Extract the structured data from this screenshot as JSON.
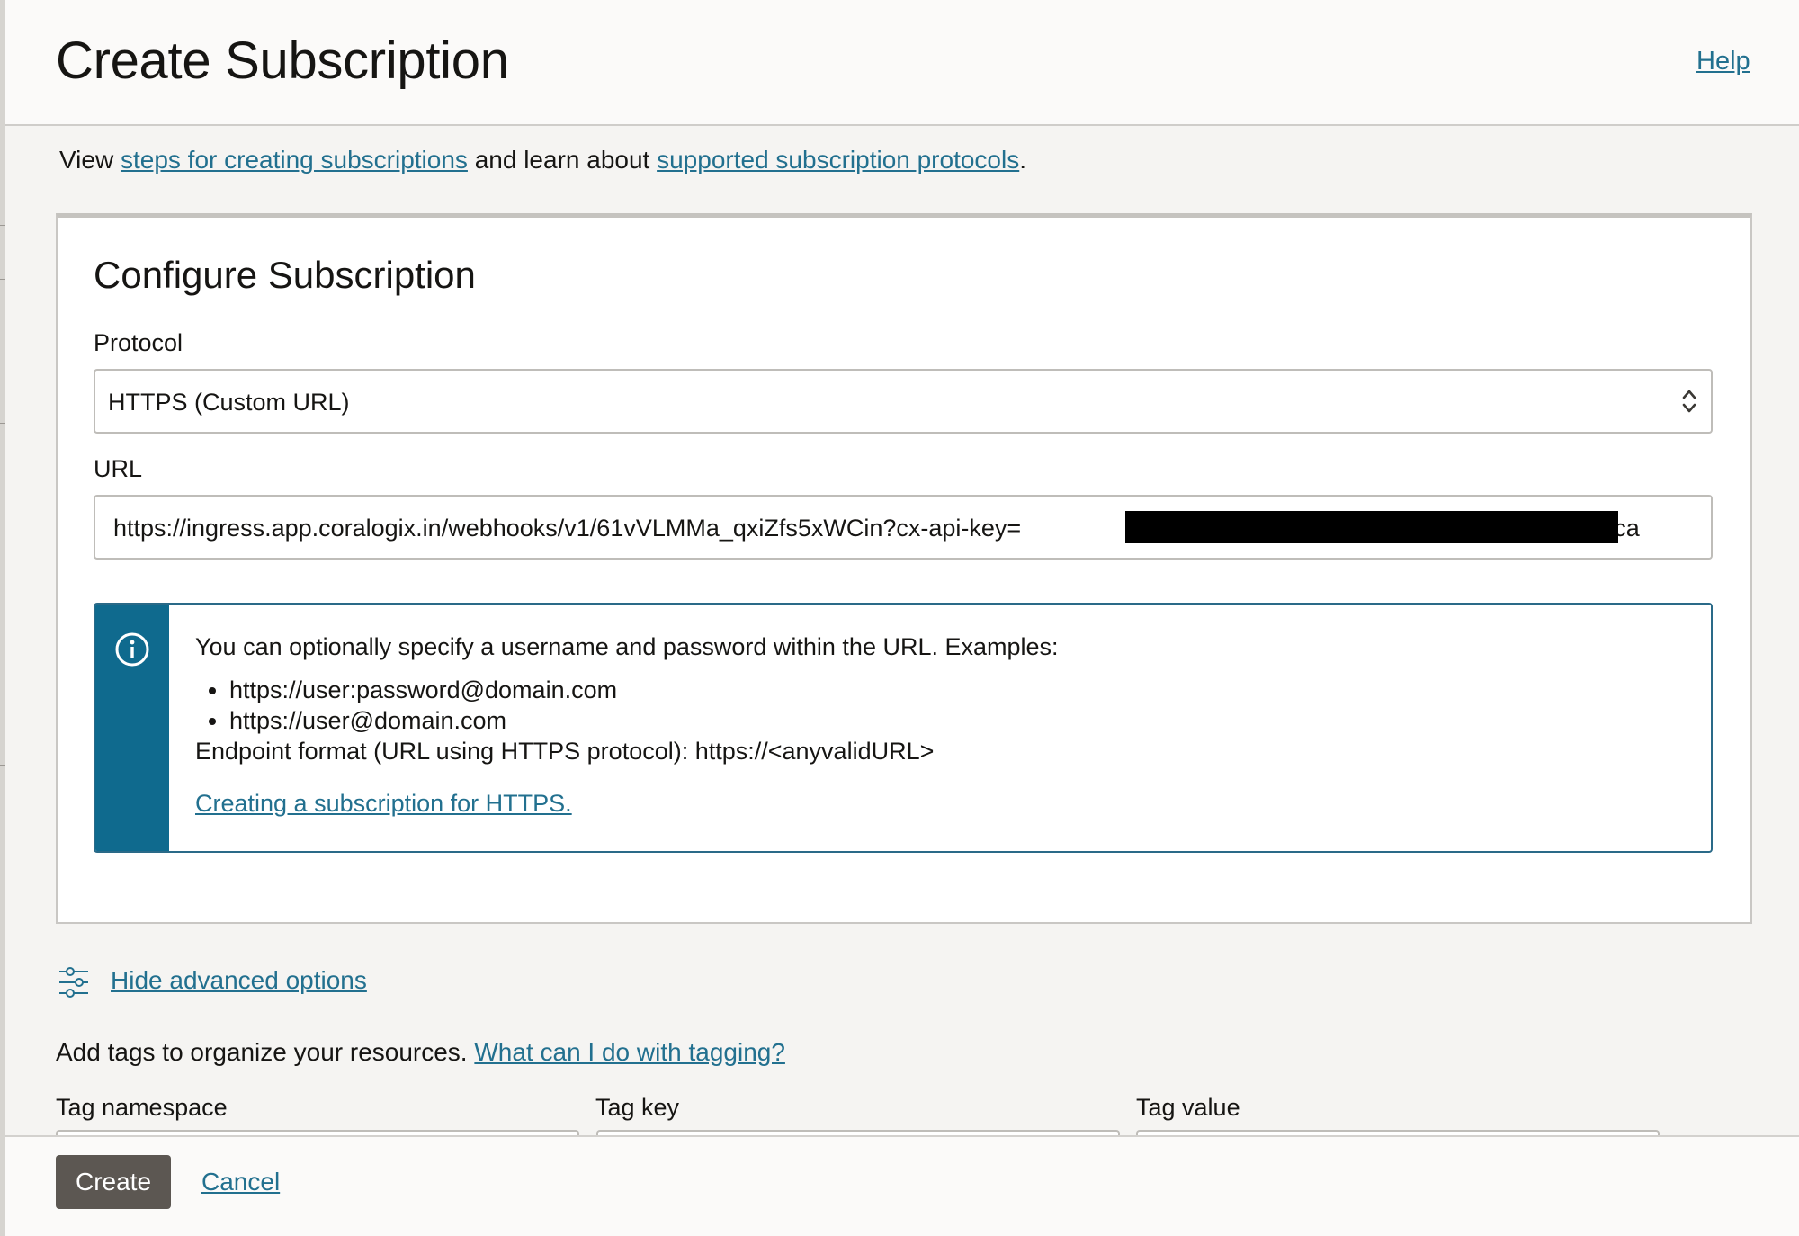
{
  "header": {
    "title": "Create Subscription",
    "help_label": "Help"
  },
  "intro": {
    "prefix": "View ",
    "link1": "steps for creating subscriptions",
    "middle": " and learn about ",
    "link2": "supported subscription protocols",
    "suffix": "."
  },
  "config": {
    "title": "Configure Subscription",
    "protocol_label": "Protocol",
    "protocol_value": "HTTPS (Custom URL)",
    "url_label": "URL",
    "url_value": "https://ingress.app.coralogix.in/webhooks/v1/61vVLMMa_qxiZfs5xWCin?cx-api-key=",
    "url_value_tail": "&cx-applica",
    "info": {
      "icon": "info-icon",
      "text": "You can optionally specify a username and password within the URL. Examples:",
      "examples": [
        "https://user:password@domain.com",
        "https://user@domain.com"
      ],
      "endpoint": "Endpoint format (URL using HTTPS protocol): https://<anyvalidURL>",
      "link": "Creating a subscription for HTTPS."
    }
  },
  "advanced": {
    "icon": "sliders-icon",
    "label": "Hide advanced options"
  },
  "tags": {
    "intro": "Add tags to organize your resources.",
    "link": "What can I do with tagging?",
    "namespace_label": "Tag namespace",
    "key_label": "Tag key",
    "value_label": "Tag value"
  },
  "footer": {
    "create_label": "Create",
    "cancel_label": "Cancel"
  },
  "colors": {
    "link": "#22708f",
    "info_bar": "#0f6a8e",
    "primary_button": "#5c5752"
  }
}
